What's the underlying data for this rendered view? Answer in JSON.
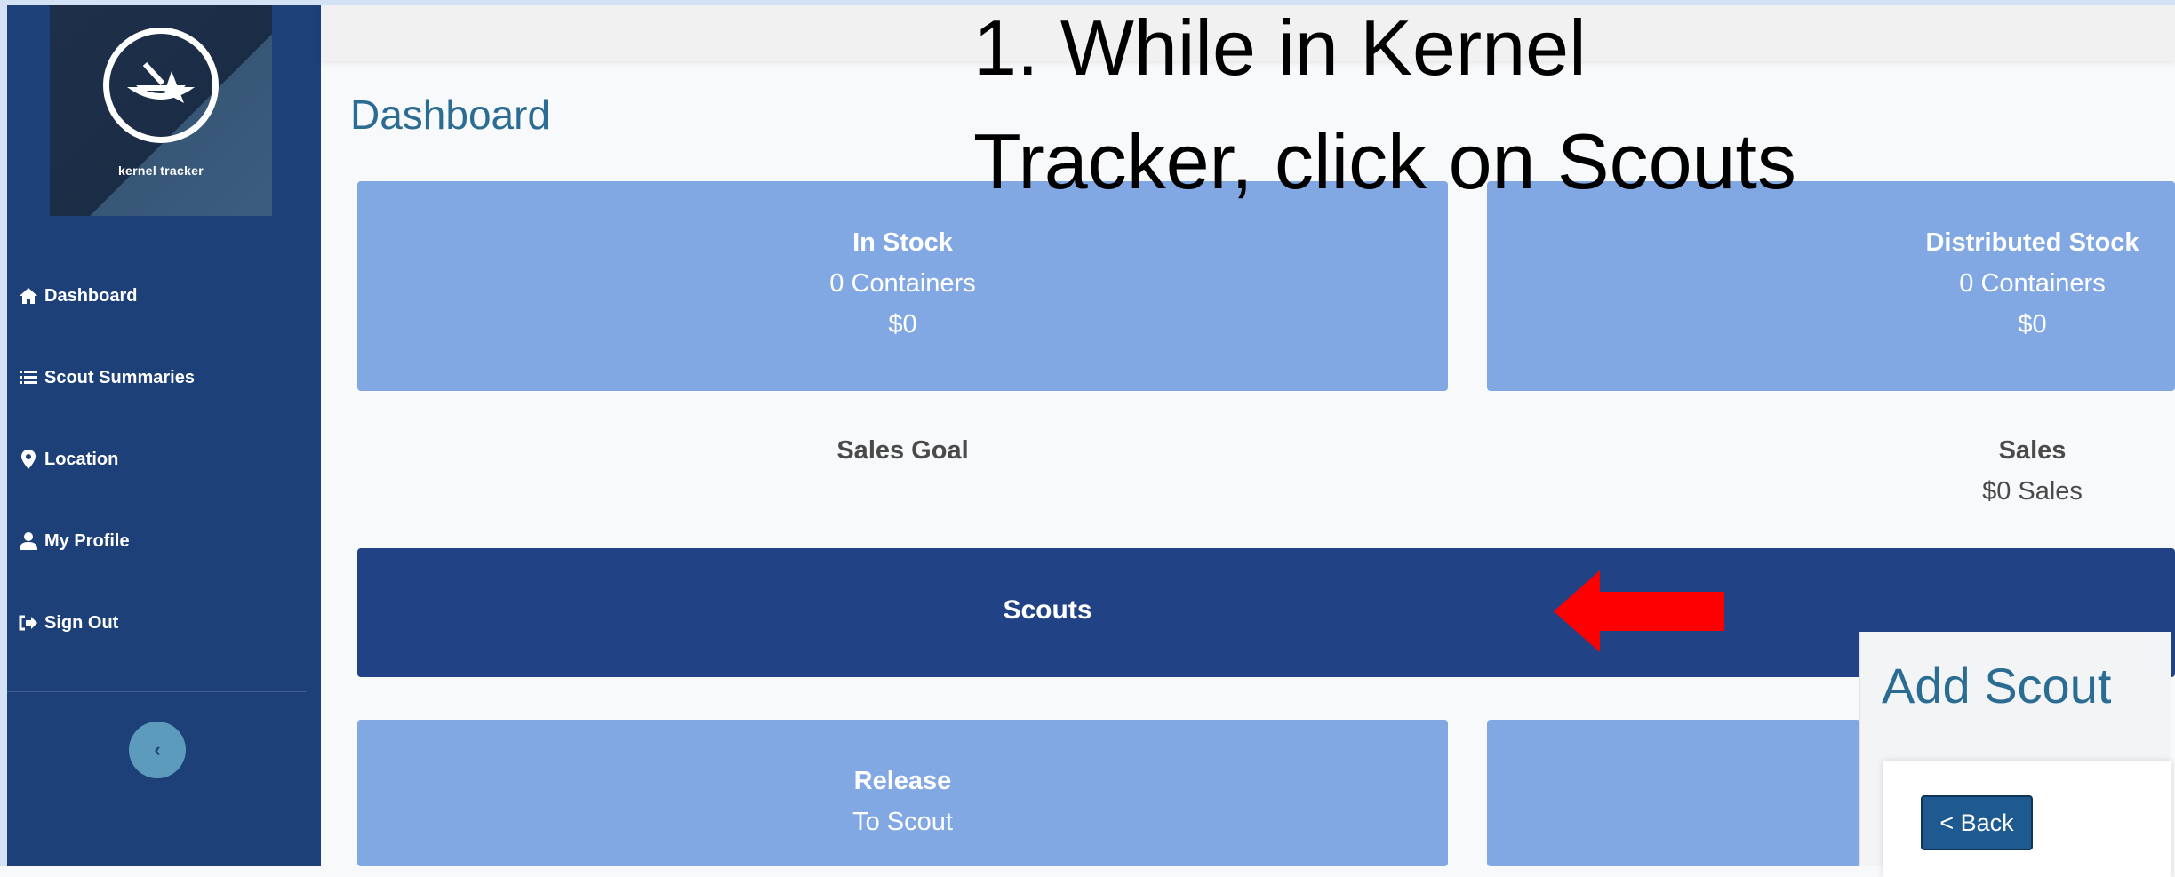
{
  "annotation": {
    "line1": "1. While in Kernel",
    "line2": "Tracker, click on Scouts"
  },
  "sidebar": {
    "logo_text": "kernel tracker",
    "items": [
      {
        "label": "Dashboard",
        "icon": "home-icon"
      },
      {
        "label": "Scout Summaries",
        "icon": "list-icon"
      },
      {
        "label": "Location",
        "icon": "map-pin-icon"
      },
      {
        "label": "My Profile",
        "icon": "user-icon"
      },
      {
        "label": "Sign Out",
        "icon": "sign-out-icon"
      }
    ],
    "collapse_glyph": "‹"
  },
  "page_title": "Dashboard",
  "cards": {
    "in_stock": {
      "title": "In Stock",
      "line1": "0 Containers",
      "line2": "$0"
    },
    "distributed": {
      "title": "Distributed Stock",
      "line1": "0 Containers",
      "line2": "$0"
    },
    "sales_goal": {
      "title": "Sales Goal"
    },
    "sales": {
      "title": "Sales",
      "line1": "$0 Sales"
    },
    "release": {
      "title": "Release",
      "line1": "To Scout"
    }
  },
  "scouts_bar": {
    "label": "Scouts"
  },
  "add_scout": {
    "title": "Add Scout",
    "back_label": "< Back"
  },
  "colors": {
    "sidebar": "#1e4079",
    "card": "#82a8e4",
    "scouts_bar": "#214386",
    "title": "#2a6c92",
    "arrow": "#ff0000"
  }
}
